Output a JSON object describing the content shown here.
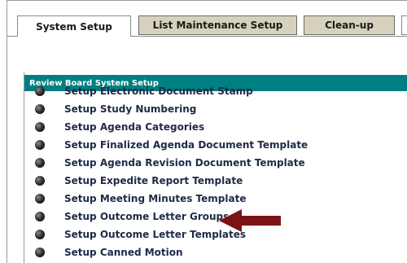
{
  "tabs": [
    {
      "label": "System Setup",
      "active": true
    },
    {
      "label": "List Maintenance Setup",
      "active": false
    },
    {
      "label": "Clean-up",
      "active": false
    }
  ],
  "panel": {
    "title": "Review Board System Setup",
    "header_color": "#007f82"
  },
  "setup_items": [
    {
      "label": "Setup Electronic Document Stamp"
    },
    {
      "label": "Setup Study Numbering"
    },
    {
      "label": "Setup Agenda Categories"
    },
    {
      "label": "Setup Finalized Agenda Document Template"
    },
    {
      "label": "Setup Agenda Revision Document Template"
    },
    {
      "label": "Setup Expedite Report Template"
    },
    {
      "label": "Setup Meeting Minutes Template"
    },
    {
      "label": "Setup Outcome Letter Groups"
    },
    {
      "label": "Setup Outcome Letter Templates"
    },
    {
      "label": "Setup Canned Motion"
    }
  ],
  "annotation": {
    "icon": "arrow-left-icon",
    "color": "#7b1416"
  }
}
